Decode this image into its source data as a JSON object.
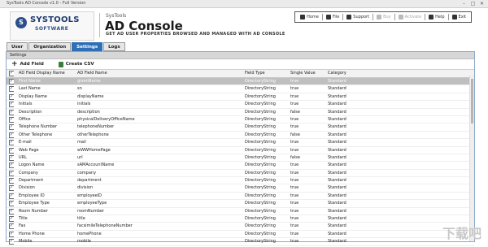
{
  "window": {
    "title": "SysTools AD Console v1.0 - Full Version",
    "minimize": "–",
    "maximize": "□",
    "close": "✕"
  },
  "brand": {
    "logo_mark": "S",
    "logo_name": "SYSTOOLS",
    "logo_sub": "SOFTWARE",
    "small": "SysTools",
    "big": "AD Console",
    "tagline": "GET AD USER PROPERTIES BROWSED AND MANAGED WITH AD CONSOLE"
  },
  "toolbar": {
    "items": [
      {
        "label": "Home",
        "icon": "home-icon"
      },
      {
        "label": "File",
        "icon": "file-icon"
      },
      {
        "label": "Support",
        "icon": "support-icon"
      },
      {
        "label": "Buy",
        "icon": "cart-icon",
        "disabled": true
      },
      {
        "label": "Activate",
        "icon": "key-icon",
        "disabled": true
      },
      {
        "label": "Help",
        "icon": "help-icon"
      },
      {
        "label": "Exit",
        "icon": "exit-icon"
      }
    ]
  },
  "tabs": [
    {
      "label": "User"
    },
    {
      "label": "Organization"
    },
    {
      "label": "Settings",
      "active": true
    },
    {
      "label": "Logs"
    }
  ],
  "panel": {
    "title": "Settings"
  },
  "actions": {
    "add_field": "Add Field",
    "create_csv": "Create CSV"
  },
  "table": {
    "headers": [
      "AD Field Display Name",
      "AD Field Name",
      "Field Type",
      "Single Value",
      "Category"
    ],
    "rows": [
      [
        "First Name",
        "givenName",
        "DirectoryString",
        "true",
        "Standard"
      ],
      [
        "Last Name",
        "sn",
        "DirectoryString",
        "true",
        "Standard"
      ],
      [
        "Display Name",
        "displayName",
        "DirectoryString",
        "true",
        "Standard"
      ],
      [
        "Initials",
        "initials",
        "DirectoryString",
        "true",
        "Standard"
      ],
      [
        "Description",
        "description",
        "DirectoryString",
        "false",
        "Standard"
      ],
      [
        "Office",
        "physicalDeliveryOfficeName",
        "DirectoryString",
        "true",
        "Standard"
      ],
      [
        "Telephone Number",
        "telephoneNumber",
        "DirectoryString",
        "true",
        "Standard"
      ],
      [
        "Other Telephone",
        "otherTelephone",
        "DirectoryString",
        "false",
        "Standard"
      ],
      [
        "E-mail",
        "mail",
        "DirectoryString",
        "true",
        "Standard"
      ],
      [
        "Web Page",
        "wWWHomePage",
        "DirectoryString",
        "true",
        "Standard"
      ],
      [
        "URL",
        "url",
        "DirectoryString",
        "false",
        "Standard"
      ],
      [
        "Logon Name",
        "sAMAccountName",
        "DirectoryString",
        "true",
        "Standard"
      ],
      [
        "Company",
        "company",
        "DirectoryString",
        "true",
        "Standard"
      ],
      [
        "Department",
        "department",
        "DirectoryString",
        "true",
        "Standard"
      ],
      [
        "Division",
        "division",
        "DirectoryString",
        "true",
        "Standard"
      ],
      [
        "Employee ID",
        "employeeID",
        "DirectoryString",
        "true",
        "Standard"
      ],
      [
        "Employee Type",
        "employeeType",
        "DirectoryString",
        "true",
        "Standard"
      ],
      [
        "Room Number",
        "roomNumber",
        "DirectoryString",
        "true",
        "Standard"
      ],
      [
        "Title",
        "title",
        "DirectoryString",
        "true",
        "Standard"
      ],
      [
        "Fax",
        "facsimileTelephoneNumber",
        "DirectoryString",
        "true",
        "Standard"
      ],
      [
        "Home Phone",
        "homePhone",
        "DirectoryString",
        "true",
        "Standard"
      ],
      [
        "Mobile",
        "mobile",
        "DirectoryString",
        "true",
        "Standard"
      ]
    ]
  },
  "watermark": "下载吧"
}
